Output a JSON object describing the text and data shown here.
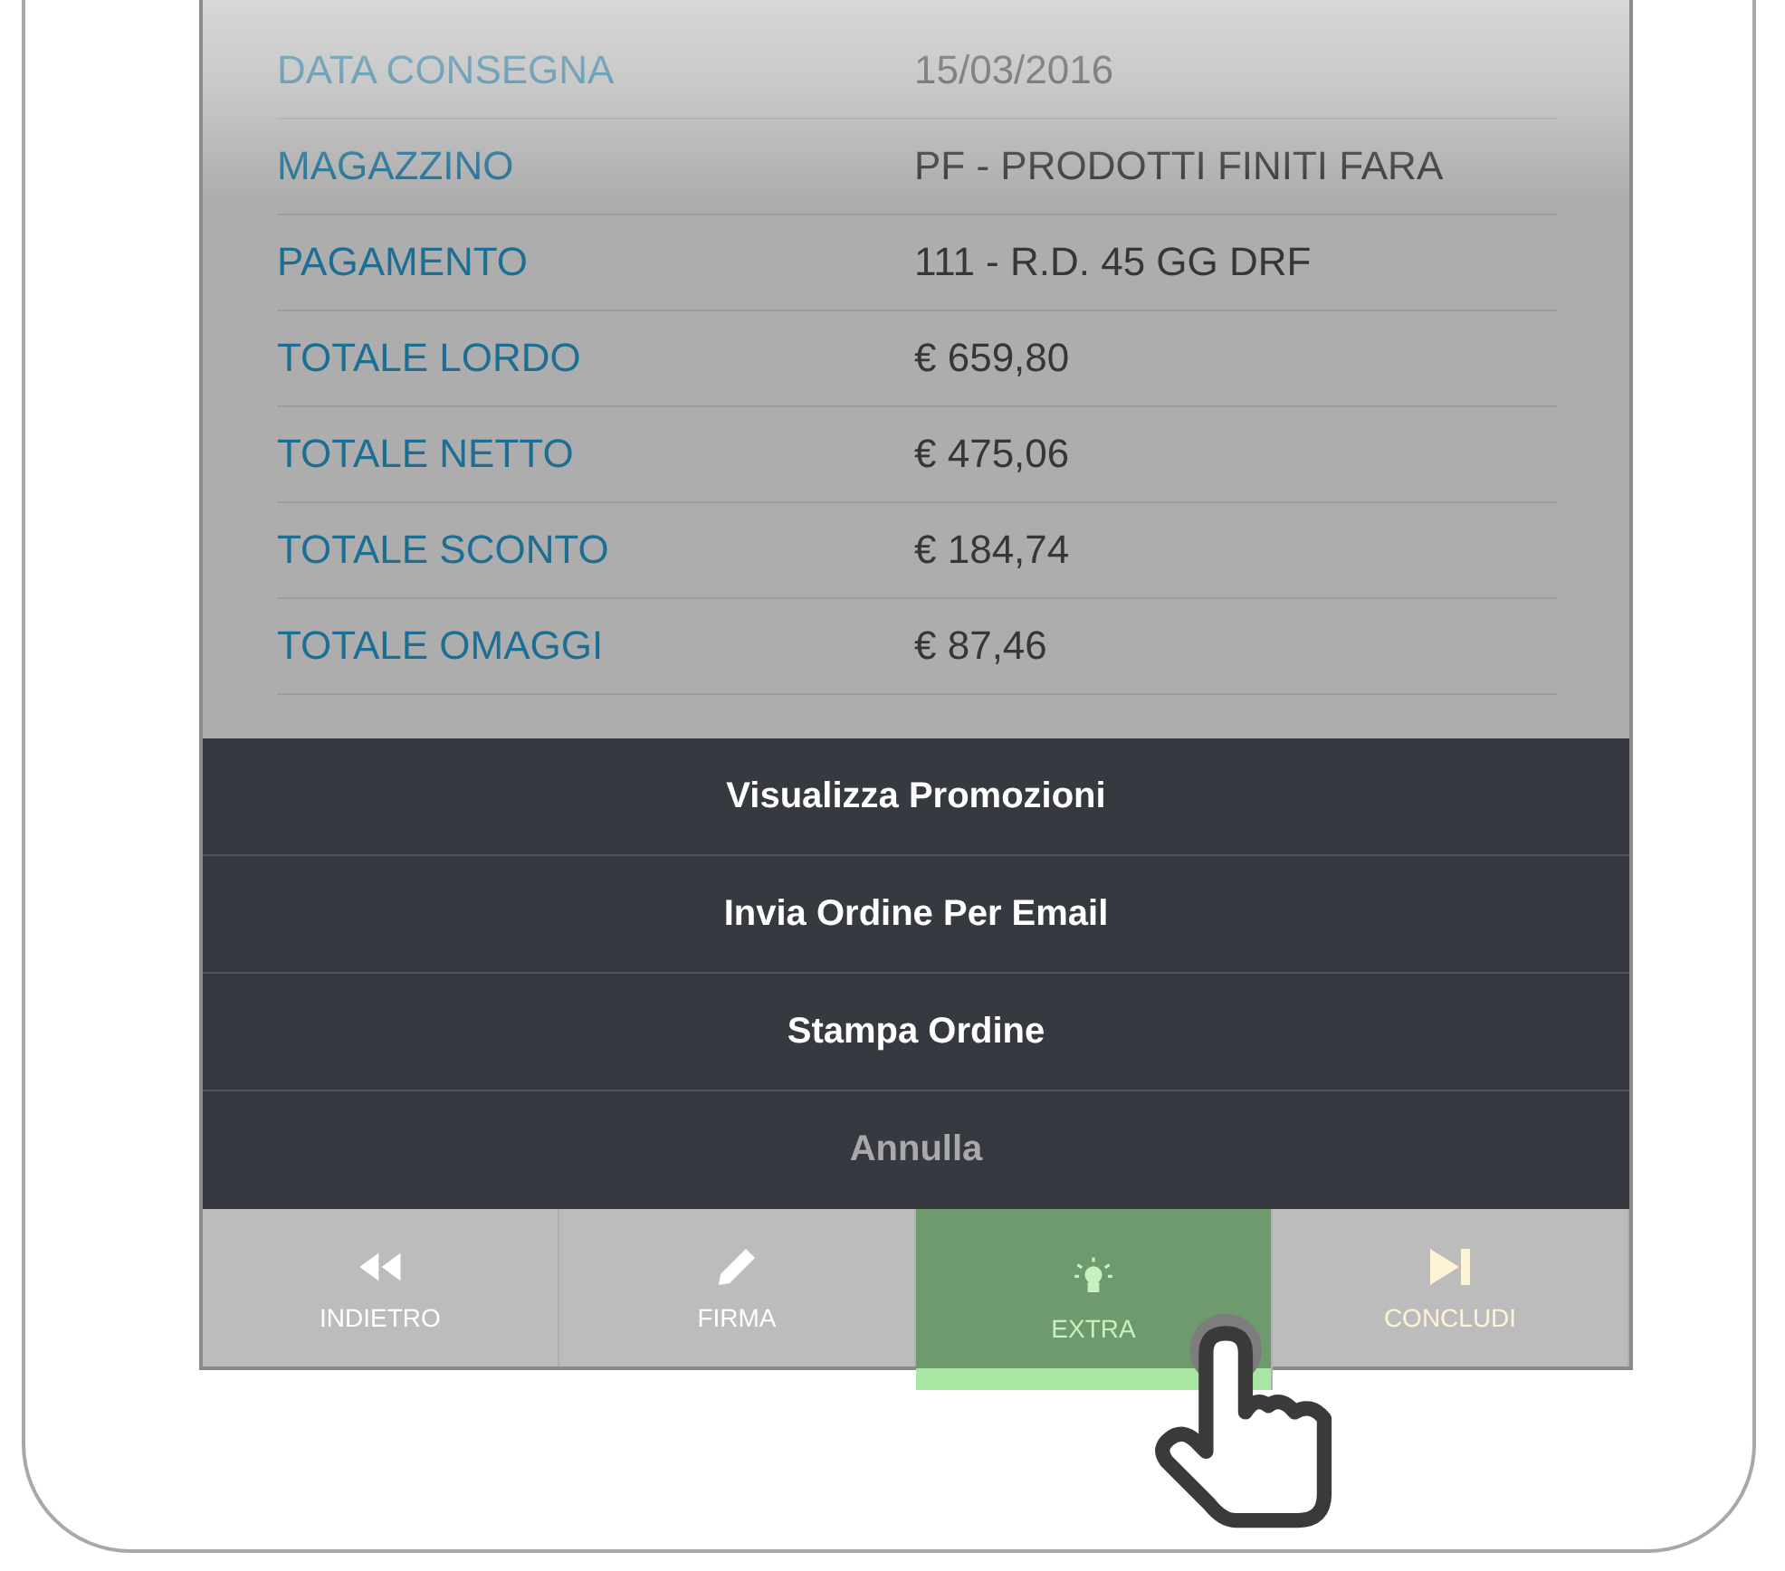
{
  "details": [
    {
      "label": "DATA CONSEGNA",
      "value": "15/03/2016"
    },
    {
      "label": "MAGAZZINO",
      "value": "PF - PRODOTTI FINITI FARA"
    },
    {
      "label": "PAGAMENTO",
      "value": "111 - R.D. 45 GG DRF"
    },
    {
      "label": "TOTALE LORDO",
      "value": "€ 659,80"
    },
    {
      "label": "TOTALE NETTO",
      "value": "€ 475,06"
    },
    {
      "label": "TOTALE SCONTO",
      "value": "€ 184,74"
    },
    {
      "label": "TOTALE OMAGGI",
      "value": "€ 87,46"
    }
  ],
  "action_sheet": [
    {
      "label": "Visualizza Promozioni",
      "kind": "action"
    },
    {
      "label": "Invia Ordine Per Email",
      "kind": "action"
    },
    {
      "label": "Stampa Ordine",
      "kind": "action"
    },
    {
      "label": "Annulla",
      "kind": "cancel"
    }
  ],
  "tabs": [
    {
      "label": "INDIETRO",
      "kind": "back",
      "selected": false
    },
    {
      "label": "FIRMA",
      "kind": "sign",
      "selected": false
    },
    {
      "label": "EXTRA",
      "kind": "extra",
      "selected": true
    },
    {
      "label": "CONCLUDI",
      "kind": "finish",
      "selected": false
    }
  ]
}
